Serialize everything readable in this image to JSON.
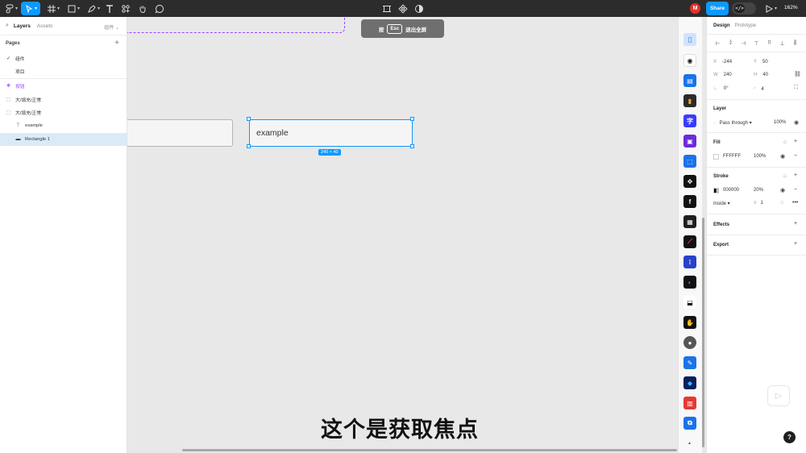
{
  "toolbar": {
    "zoom": "162%",
    "share_label": "Share",
    "avatar_initial": "M",
    "dev_mode_glyph": "</>"
  },
  "left_panel": {
    "tabs": [
      "Layers",
      "Assets"
    ],
    "page_selector": "组件 ⌄",
    "pages_title": "Pages",
    "pages": [
      {
        "label": "组件",
        "current": true
      },
      {
        "label": "项目",
        "current": false
      }
    ],
    "layers": [
      {
        "label": "按钮",
        "icon": "component-icon"
      },
      {
        "label": "大/填充/正常",
        "icon": "frame-icon"
      },
      {
        "label": "大/填充/正常",
        "icon": "frame-icon"
      },
      {
        "label": "example",
        "icon": "text-icon"
      },
      {
        "label": "Rectangle 1",
        "icon": "rectangle-icon"
      }
    ]
  },
  "canvas": {
    "esc_hint": {
      "before": "按",
      "key": "Esc",
      "after": "退出全屏"
    },
    "field_text": "example",
    "size_tag": "240 × 40",
    "subtitle": "这个是获取焦点"
  },
  "right_panel": {
    "tabs": [
      "Design",
      "Prototype"
    ],
    "x": "-244",
    "y": "50",
    "w": "240",
    "h": "40",
    "rotation": "0°",
    "radius": "4",
    "layer_title": "Layer",
    "blend_mode": "Pass through",
    "opacity": "100%",
    "fill_title": "Fill",
    "fill_hex": "FFFFFF",
    "fill_opacity": "100%",
    "stroke_title": "Stroke",
    "stroke_hex": "000000",
    "stroke_opacity": "20%",
    "stroke_position": "Inside",
    "stroke_weight": "1",
    "effects_title": "Effects",
    "export_title": "Export"
  },
  "colors": {
    "accent": "#0d99ff",
    "component": "#9747ff",
    "toolbar_bg": "#2c2c2c"
  }
}
